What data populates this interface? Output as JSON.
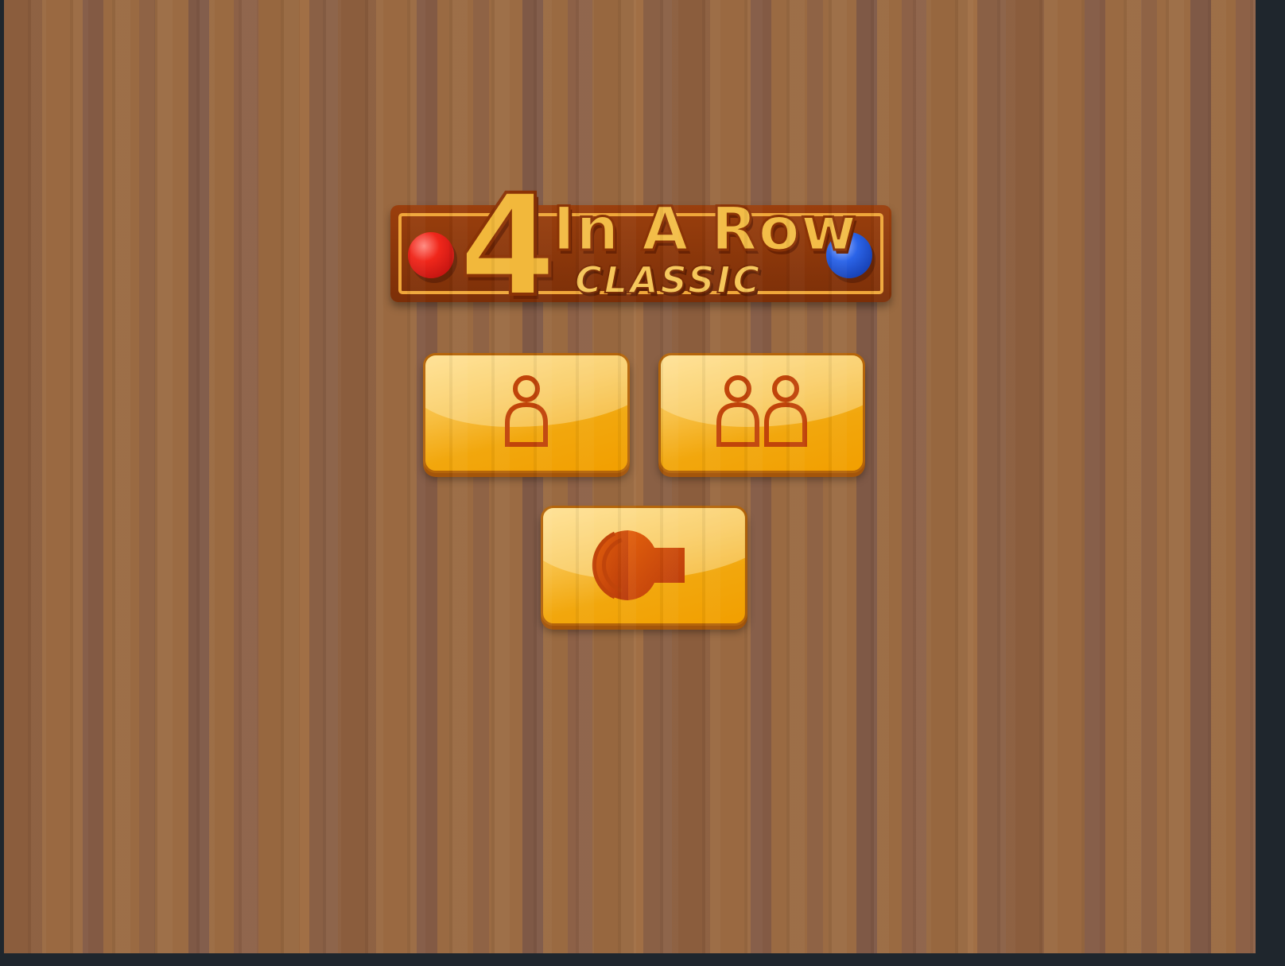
{
  "logo": {
    "number": "4",
    "title": "In A Row",
    "subtitle": "CLASSIC"
  },
  "buttons": [
    {
      "action": "one-player",
      "icon": "single-player-icon"
    },
    {
      "action": "two-player",
      "icon": "two-players-icon"
    },
    {
      "action": "sound",
      "icon": "speaker-icon"
    }
  ],
  "colors": {
    "button_fill": "#f7b52a",
    "icon_color": "#c0440a",
    "red_disc": "#e8231a",
    "blue_disc": "#2a5fe0",
    "plate": "#8f390b"
  }
}
